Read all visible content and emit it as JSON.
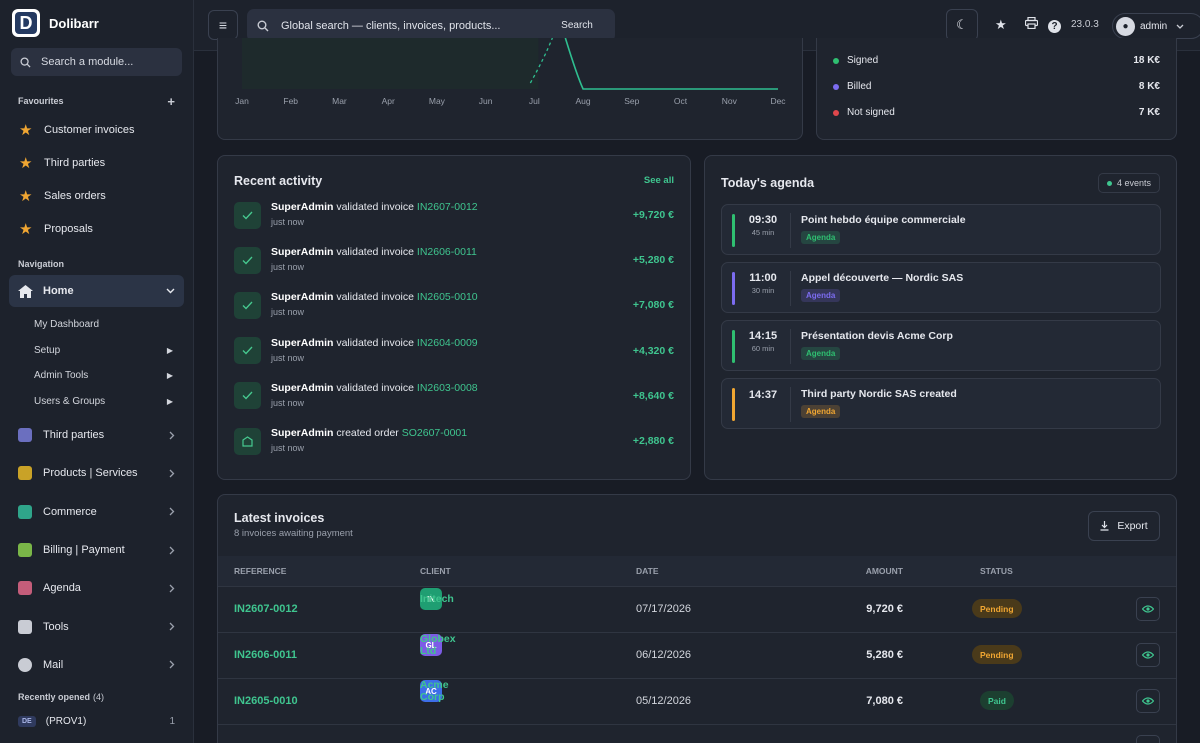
{
  "brand": {
    "name": "Dolibarr",
    "logo_letter": "D"
  },
  "sidebar": {
    "search_placeholder": "Search a module...",
    "favourites_label": "Favourites",
    "favourites": [
      {
        "label": "Customer invoices"
      },
      {
        "label": "Third parties"
      },
      {
        "label": "Sales orders"
      },
      {
        "label": "Proposals"
      }
    ],
    "navigation_label": "Navigation",
    "home": {
      "label": "Home"
    },
    "home_sub": [
      {
        "label": "My Dashboard"
      },
      {
        "label": "Setup"
      },
      {
        "label": "Admin Tools"
      },
      {
        "label": "Users & Groups"
      }
    ],
    "nav": [
      {
        "label": "Third parties",
        "icon": "building-icon",
        "color": "#6b6fbf"
      },
      {
        "label": "Products | Services",
        "icon": "box-icon",
        "color": "#c9a227"
      },
      {
        "label": "Commerce",
        "icon": "briefcase-icon",
        "color": "#2fa58a"
      },
      {
        "label": "Billing | Payment",
        "icon": "bill-icon",
        "color": "#7ab648"
      },
      {
        "label": "Agenda",
        "icon": "calendar-icon",
        "color": "#c45d7a"
      },
      {
        "label": "Tools",
        "icon": "tools-icon",
        "color": "#c9ccd4"
      },
      {
        "label": "Mail",
        "icon": "mail-icon",
        "color": "#c9ccd4"
      }
    ],
    "recent_label": "Recently opened",
    "recent_count": "(4)",
    "recent": [
      {
        "badge": "DE",
        "label": "(PROV1)",
        "count": "1"
      }
    ]
  },
  "topbar": {
    "search_placeholder": "Global search — clients, invoices, products...",
    "search_button": "Search",
    "version": "23.0.3",
    "user": "admin"
  },
  "chart_data": {
    "type": "line",
    "categories": [
      "Jan",
      "Feb",
      "Mar",
      "Apr",
      "May",
      "Jun",
      "Jul",
      "Aug",
      "Sep",
      "Oct",
      "Nov",
      "Dec"
    ]
  },
  "summary": [
    {
      "label": "Signed",
      "value": "18 K€",
      "color": "#2fbf71"
    },
    {
      "label": "Billed",
      "value": "8 K€",
      "color": "#7c6cf0"
    },
    {
      "label": "Not signed",
      "value": "7 K€",
      "color": "#e0474c"
    }
  ],
  "activity": {
    "title": "Recent activity",
    "see_all": "See all",
    "items": [
      {
        "user": "SuperAdmin",
        "action": "validated invoice",
        "ref": "IN2607-0012",
        "time": "just now",
        "amount": "+9,720 €",
        "icon": "check-icon"
      },
      {
        "user": "SuperAdmin",
        "action": "validated invoice",
        "ref": "IN2606-0011",
        "time": "just now",
        "amount": "+5,280 €",
        "icon": "check-icon"
      },
      {
        "user": "SuperAdmin",
        "action": "validated invoice",
        "ref": "IN2605-0010",
        "time": "just now",
        "amount": "+7,080 €",
        "icon": "check-icon"
      },
      {
        "user": "SuperAdmin",
        "action": "validated invoice",
        "ref": "IN2604-0009",
        "time": "just now",
        "amount": "+4,320 €",
        "icon": "check-icon"
      },
      {
        "user": "SuperAdmin",
        "action": "validated invoice",
        "ref": "IN2603-0008",
        "time": "just now",
        "amount": "+8,640 €",
        "icon": "check-icon"
      },
      {
        "user": "SuperAdmin",
        "action": "created order",
        "ref": "SO2607-0001",
        "time": "just now",
        "amount": "+2,880 €",
        "icon": "order-icon"
      }
    ]
  },
  "agenda": {
    "title": "Today's agenda",
    "events_badge": "4 events",
    "events": [
      {
        "time": "09:30",
        "duration": "45 min",
        "title": "Point hebdo équipe commerciale",
        "tag": "Agenda",
        "color": "#2fbf71"
      },
      {
        "time": "11:00",
        "duration": "30 min",
        "title": "Appel découverte — Nordic SAS",
        "tag": "Agenda",
        "color": "#7c6cf0"
      },
      {
        "time": "14:15",
        "duration": "60 min",
        "title": "Présentation devis Acme Corp",
        "tag": "Agenda",
        "color": "#2fbf71"
      },
      {
        "time": "14:37",
        "duration": "",
        "title": "Third party Nordic SAS created",
        "tag": "Agenda",
        "color": "#f0a632"
      }
    ]
  },
  "invoices": {
    "title": "Latest invoices",
    "subtitle": "8 invoices awaiting payment",
    "export_label": "Export",
    "columns": {
      "reference": "REFERENCE",
      "client": "CLIENT",
      "date": "DATE",
      "amount": "AMOUNT",
      "status": "STATUS"
    },
    "rows": [
      {
        "ref": "IN2607-0012",
        "initials": "IN",
        "client": "Initech",
        "date": "07/17/2026",
        "amount": "9,720 €",
        "status": "Pending",
        "avatar_color": "#1f9e72"
      },
      {
        "ref": "IN2606-0011",
        "initials": "GL",
        "client": "Globex Ltd",
        "date": "06/12/2026",
        "amount": "5,280 €",
        "status": "Pending",
        "avatar_color": "#7c5ce6"
      },
      {
        "ref": "IN2605-0010",
        "initials": "AC",
        "client": "Acme Corp",
        "date": "05/12/2026",
        "amount": "7,080 €",
        "status": "Paid",
        "avatar_color": "#3d6ee8"
      }
    ]
  }
}
